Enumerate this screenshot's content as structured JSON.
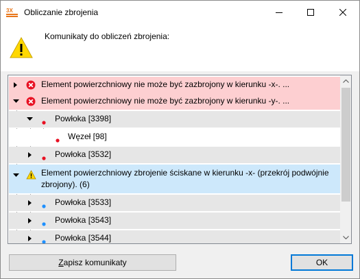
{
  "window": {
    "title": "Obliczanie zbrojenia"
  },
  "header": {
    "message": "Komunikaty do obliczeń zbrojenia:"
  },
  "tree": {
    "rows": [
      {
        "text": "Element powierzchniowy nie może być zazbrojony w kierunku -x-. ...",
        "kind": "error",
        "state": "collapsed"
      },
      {
        "text": "Element powierzchniowy nie może być zazbrojony w kierunku -y-. ...",
        "kind": "error",
        "state": "expanded"
      },
      {
        "text": "Powłoka [3398]",
        "kind": "red-dot",
        "state": "expanded"
      },
      {
        "text": "Węzeł [98]",
        "kind": "red-dot",
        "state": "leaf"
      },
      {
        "text": "Powłoka [3532]",
        "kind": "red-dot",
        "state": "collapsed"
      },
      {
        "text": "Element powierzchniowy zbrojenie ściskane w kierunku -x- (przekrój podwójnie zbrojony). (6)",
        "kind": "warning",
        "state": "expanded"
      },
      {
        "text": "Powłoka [3533]",
        "kind": "blue-dot",
        "state": "collapsed"
      },
      {
        "text": "Powłoka [3543]",
        "kind": "blue-dot",
        "state": "collapsed"
      },
      {
        "text": "Powłoka [3544]",
        "kind": "blue-dot",
        "state": "collapsed"
      }
    ]
  },
  "buttons": {
    "save_prefix": "Z",
    "save_rest": "apisz komunikaty",
    "ok": "OK"
  },
  "colors": {
    "error_row": "#fdcfd1",
    "warning_row": "#cde8fb",
    "error_icon": "#e81123",
    "warning_icon": "#ffd800",
    "blue_dot": "#1e90ff"
  },
  "icons": [
    "app-logo-icon",
    "minimize-icon",
    "maximize-icon",
    "close-icon",
    "warning-icon",
    "error-icon",
    "expand-caret-icon",
    "collapse-caret-icon",
    "bullet-icon",
    "scroll-up-icon",
    "scroll-down-icon"
  ]
}
